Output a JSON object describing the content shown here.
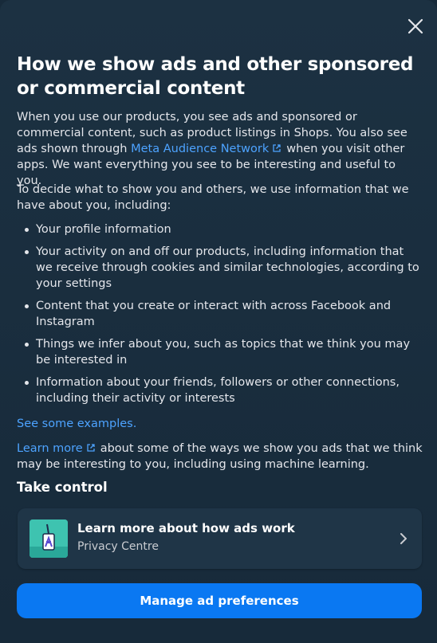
{
  "dialog": {
    "close_label": "",
    "title": "How we show ads and other sponsored or commercial content"
  },
  "intro": {
    "text_before_link": "When you use our products, you see ads and sponsored or commercial content, such as product listings in Shops. You also see ads shown through ",
    "link_label": "Meta Audience Network",
    "text_after_link": "when you visit other apps. We want everything you see to be interesting and useful to you."
  },
  "decide": {
    "text": "To decide what to show you and others, we use information that we have about you, including:"
  },
  "bullets": [
    "Your profile information",
    "Your activity on and off our products, including information that we receive through cookies and similar technologies, according to your settings",
    "Content that you create or interact with across Facebook and Instagram",
    "Things we infer about you, such as topics that we think you may be interested in",
    "Information about your friends, followers or other connections, including their activity or interests"
  ],
  "examples_link": "See some examples.",
  "learn": {
    "link_label": "Learn more",
    "text_after_link": "about some of the ways we show you ads that we think may be interesting to you, including using machine learning."
  },
  "take_control": {
    "heading": "Take control",
    "card_title": "Learn more about how ads work",
    "card_subtitle": "Privacy Centre"
  },
  "cta": {
    "label": "Manage ad preferences"
  },
  "colors": {
    "background": "#172a3a",
    "link": "#4da3ff",
    "button": "#0a78f2",
    "thumb": "#3ec3b0"
  },
  "icons": {
    "close": "close-icon",
    "external": "external-link-icon",
    "chevron": "chevron-right-icon",
    "thumb": "ads-illustration-icon"
  }
}
